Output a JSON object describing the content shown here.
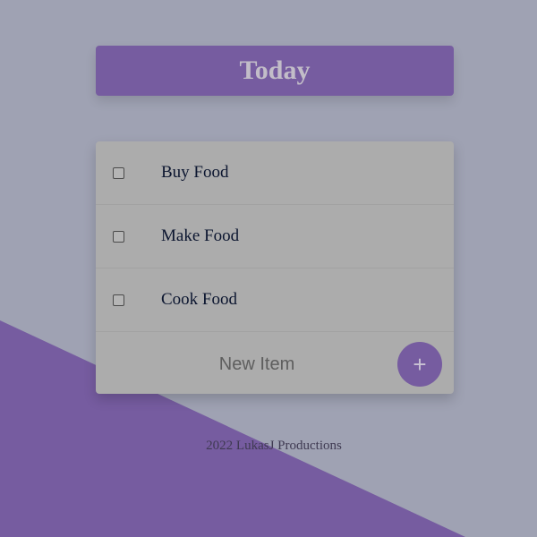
{
  "theme": {
    "background": "#9fa2b3",
    "accent": "#765ca0",
    "card": "#acacac"
  },
  "heading": {
    "title": "Today"
  },
  "todo": {
    "items": [
      {
        "label": "Buy Food",
        "checked": false
      },
      {
        "label": "Make Food",
        "checked": false
      },
      {
        "label": "Cook Food",
        "checked": false
      }
    ],
    "new_item_placeholder": "New Item",
    "add_button_label": "+",
    "add_button_icon": "plus-icon"
  },
  "footer": {
    "text": "2022 LukasJ Productions"
  }
}
